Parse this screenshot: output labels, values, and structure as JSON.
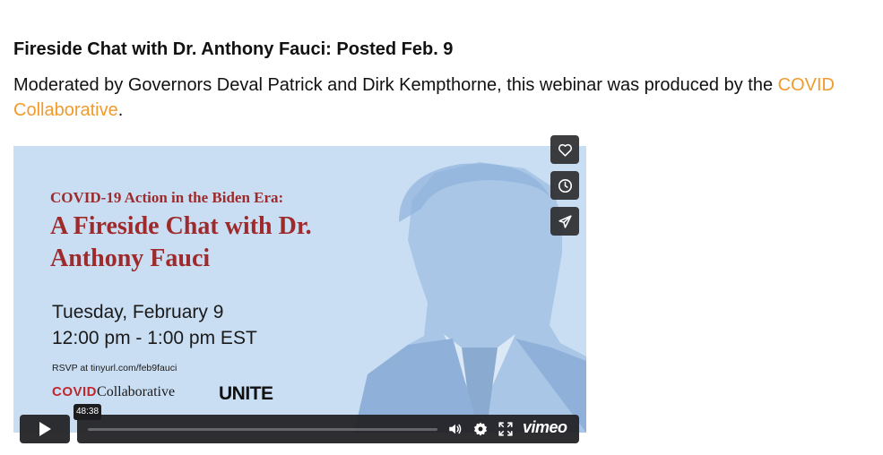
{
  "article": {
    "heading": "Fireside Chat with Dr. Anthony Fauci: Posted Feb. 9",
    "description_prefix": "Moderated by Governors Deval Patrick and Dirk Kempthorne, this webinar was produced by the ",
    "description_link": "COVID Collaborative",
    "description_suffix": "."
  },
  "poster": {
    "subtitle": "COVID-19 Action in the Biden Era:",
    "title": "A Fireside Chat with Dr. Anthony Fauci",
    "date": "Tuesday, February 9",
    "time": "12:00 pm - 1:00 pm EST",
    "rsvp": "RSVP at tinyurl.com/feb9fauci",
    "logo_covid_bold": "COVID",
    "logo_covid_rest": "Collaborative",
    "logo_unite": "UNITE"
  },
  "player": {
    "duration": "48:38",
    "brand": "vimeo",
    "side_buttons": [
      "heart-icon",
      "clock-icon",
      "send-icon"
    ],
    "controls": [
      "play-icon",
      "volume-icon",
      "settings-gear-icon",
      "fullscreen-icon"
    ]
  },
  "colors": {
    "link": "#f39a2c",
    "poster_bg": "#c9def3",
    "poster_red": "#9e2a2b",
    "control_bg": "#232326"
  }
}
